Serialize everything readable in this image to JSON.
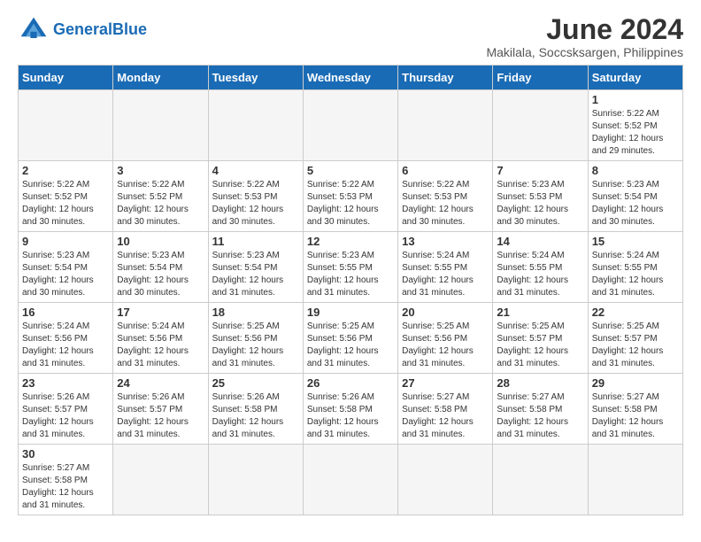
{
  "logo": {
    "text_general": "General",
    "text_blue": "Blue"
  },
  "title": "June 2024",
  "subtitle": "Makilala, Soccsksargen, Philippines",
  "days_of_week": [
    "Sunday",
    "Monday",
    "Tuesday",
    "Wednesday",
    "Thursday",
    "Friday",
    "Saturday"
  ],
  "weeks": [
    [
      {
        "day": "",
        "info": "",
        "empty": true
      },
      {
        "day": "",
        "info": "",
        "empty": true
      },
      {
        "day": "",
        "info": "",
        "empty": true
      },
      {
        "day": "",
        "info": "",
        "empty": true
      },
      {
        "day": "",
        "info": "",
        "empty": true
      },
      {
        "day": "",
        "info": "",
        "empty": true
      },
      {
        "day": "1",
        "info": "Sunrise: 5:22 AM\nSunset: 5:52 PM\nDaylight: 12 hours and 29 minutes."
      }
    ],
    [
      {
        "day": "2",
        "info": "Sunrise: 5:22 AM\nSunset: 5:52 PM\nDaylight: 12 hours and 30 minutes."
      },
      {
        "day": "3",
        "info": "Sunrise: 5:22 AM\nSunset: 5:52 PM\nDaylight: 12 hours and 30 minutes."
      },
      {
        "day": "4",
        "info": "Sunrise: 5:22 AM\nSunset: 5:53 PM\nDaylight: 12 hours and 30 minutes."
      },
      {
        "day": "5",
        "info": "Sunrise: 5:22 AM\nSunset: 5:53 PM\nDaylight: 12 hours and 30 minutes."
      },
      {
        "day": "6",
        "info": "Sunrise: 5:22 AM\nSunset: 5:53 PM\nDaylight: 12 hours and 30 minutes."
      },
      {
        "day": "7",
        "info": "Sunrise: 5:23 AM\nSunset: 5:53 PM\nDaylight: 12 hours and 30 minutes."
      },
      {
        "day": "8",
        "info": "Sunrise: 5:23 AM\nSunset: 5:54 PM\nDaylight: 12 hours and 30 minutes."
      }
    ],
    [
      {
        "day": "9",
        "info": "Sunrise: 5:23 AM\nSunset: 5:54 PM\nDaylight: 12 hours and 30 minutes."
      },
      {
        "day": "10",
        "info": "Sunrise: 5:23 AM\nSunset: 5:54 PM\nDaylight: 12 hours and 30 minutes."
      },
      {
        "day": "11",
        "info": "Sunrise: 5:23 AM\nSunset: 5:54 PM\nDaylight: 12 hours and 31 minutes."
      },
      {
        "day": "12",
        "info": "Sunrise: 5:23 AM\nSunset: 5:55 PM\nDaylight: 12 hours and 31 minutes."
      },
      {
        "day": "13",
        "info": "Sunrise: 5:24 AM\nSunset: 5:55 PM\nDaylight: 12 hours and 31 minutes."
      },
      {
        "day": "14",
        "info": "Sunrise: 5:24 AM\nSunset: 5:55 PM\nDaylight: 12 hours and 31 minutes."
      },
      {
        "day": "15",
        "info": "Sunrise: 5:24 AM\nSunset: 5:55 PM\nDaylight: 12 hours and 31 minutes."
      }
    ],
    [
      {
        "day": "16",
        "info": "Sunrise: 5:24 AM\nSunset: 5:56 PM\nDaylight: 12 hours and 31 minutes."
      },
      {
        "day": "17",
        "info": "Sunrise: 5:24 AM\nSunset: 5:56 PM\nDaylight: 12 hours and 31 minutes."
      },
      {
        "day": "18",
        "info": "Sunrise: 5:25 AM\nSunset: 5:56 PM\nDaylight: 12 hours and 31 minutes."
      },
      {
        "day": "19",
        "info": "Sunrise: 5:25 AM\nSunset: 5:56 PM\nDaylight: 12 hours and 31 minutes."
      },
      {
        "day": "20",
        "info": "Sunrise: 5:25 AM\nSunset: 5:56 PM\nDaylight: 12 hours and 31 minutes."
      },
      {
        "day": "21",
        "info": "Sunrise: 5:25 AM\nSunset: 5:57 PM\nDaylight: 12 hours and 31 minutes."
      },
      {
        "day": "22",
        "info": "Sunrise: 5:25 AM\nSunset: 5:57 PM\nDaylight: 12 hours and 31 minutes."
      }
    ],
    [
      {
        "day": "23",
        "info": "Sunrise: 5:26 AM\nSunset: 5:57 PM\nDaylight: 12 hours and 31 minutes."
      },
      {
        "day": "24",
        "info": "Sunrise: 5:26 AM\nSunset: 5:57 PM\nDaylight: 12 hours and 31 minutes."
      },
      {
        "day": "25",
        "info": "Sunrise: 5:26 AM\nSunset: 5:58 PM\nDaylight: 12 hours and 31 minutes."
      },
      {
        "day": "26",
        "info": "Sunrise: 5:26 AM\nSunset: 5:58 PM\nDaylight: 12 hours and 31 minutes."
      },
      {
        "day": "27",
        "info": "Sunrise: 5:27 AM\nSunset: 5:58 PM\nDaylight: 12 hours and 31 minutes."
      },
      {
        "day": "28",
        "info": "Sunrise: 5:27 AM\nSunset: 5:58 PM\nDaylight: 12 hours and 31 minutes."
      },
      {
        "day": "29",
        "info": "Sunrise: 5:27 AM\nSunset: 5:58 PM\nDaylight: 12 hours and 31 minutes."
      }
    ],
    [
      {
        "day": "30",
        "info": "Sunrise: 5:27 AM\nSunset: 5:58 PM\nDaylight: 12 hours and 31 minutes."
      },
      {
        "day": "",
        "info": "",
        "empty": true
      },
      {
        "day": "",
        "info": "",
        "empty": true
      },
      {
        "day": "",
        "info": "",
        "empty": true
      },
      {
        "day": "",
        "info": "",
        "empty": true
      },
      {
        "day": "",
        "info": "",
        "empty": true
      },
      {
        "day": "",
        "info": "",
        "empty": true
      }
    ]
  ]
}
